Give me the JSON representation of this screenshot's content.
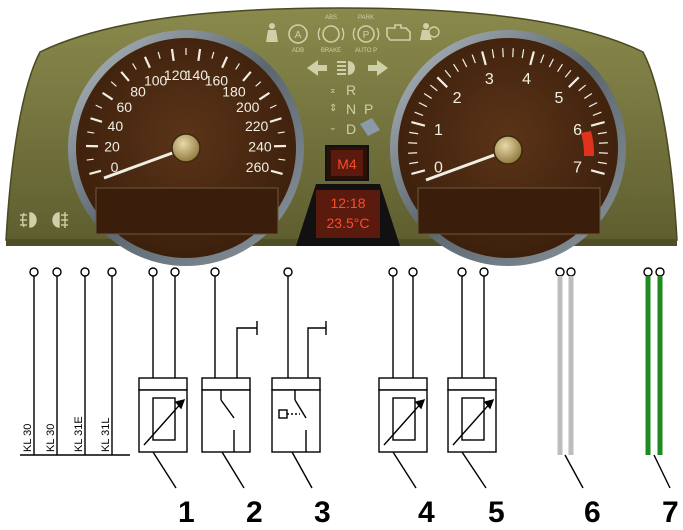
{
  "cluster": {
    "colors": {
      "panel": "#7b7a42",
      "panel_dark": "#5f5e30",
      "dial_face": "#4a2a12",
      "bezel": "#55606a",
      "bezel_light": "#9aa3ab",
      "needle": "#f1efe4",
      "red_zone": "#e0321c",
      "lcd_text": "#ff4a2a",
      "lcd_bg": "#5a1a0e",
      "indicator": "#cfd0a8"
    },
    "speedometer": {
      "ticks": [
        "0",
        "20",
        "40",
        "60",
        "80",
        "100",
        "120",
        "140",
        "160",
        "180",
        "200",
        "220",
        "240",
        "260"
      ]
    },
    "tachometer": {
      "ticks": [
        "0",
        "1",
        "2",
        "3",
        "4",
        "5",
        "6",
        "7"
      ]
    },
    "gear_display": "M4",
    "clock": "12:18",
    "temperature": "23.5°C",
    "gear_selector": {
      "r": "R",
      "n": "N",
      "p": "P",
      "d": "D"
    },
    "warning_labels": {
      "abs": "ABS",
      "park": "PARK",
      "adb": "ADB",
      "brake": "BRAKE",
      "auto_p": "AUTO P"
    },
    "icons": [
      "seatbelt-warning-icon",
      "adb-icon",
      "abs-brake-icon",
      "park-brake-icon",
      "engine-check-icon",
      "airbag-icon",
      "turn-left-icon",
      "high-beam-icon",
      "turn-right-icon",
      "front-fog-light-icon",
      "rear-fog-light-icon"
    ]
  },
  "circuit": {
    "terminals": [
      "KL 30",
      "KL 30",
      "KL 31E",
      "KL 31L"
    ],
    "callouts": [
      "1",
      "2",
      "3",
      "4",
      "5",
      "6",
      "7"
    ],
    "wire_colors": {
      "gray": "#bdbdbd",
      "green": "#1f8a1f"
    }
  }
}
